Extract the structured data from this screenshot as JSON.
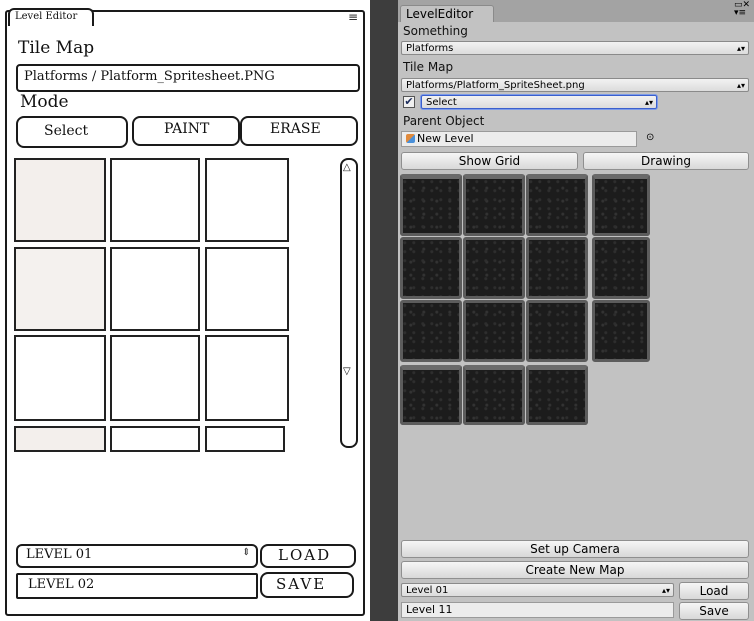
{
  "sketch": {
    "tab": "Level Editor",
    "tile_map_label": "Tile Map",
    "tile_map_path": "Platforms / Platform_Spritesheet.PNG",
    "mode_label": "Mode",
    "mode_buttons": [
      "Select",
      "PAINT",
      "ERASE"
    ],
    "level_dropdown": "LEVEL 01",
    "load": "LOAD",
    "level_field": "LEVEL 02",
    "save": "SAVE"
  },
  "panel": {
    "tab": "LevelEditor",
    "something_label": "Something",
    "something_value": "Platforms",
    "tile_map_label": "Tile Map",
    "tile_map_value": "Platforms/Platform_SpriteSheet.png",
    "mode_value": "Select",
    "parent_label": "Parent Object",
    "parent_value": "New Level",
    "show_grid": "Show Grid",
    "drawing": "Drawing",
    "setup_camera": "Set up Camera",
    "create_map": "Create New Map",
    "level_dropdown": "Level 01",
    "load": "Load",
    "level_field": "Level 11",
    "save": "Save"
  }
}
